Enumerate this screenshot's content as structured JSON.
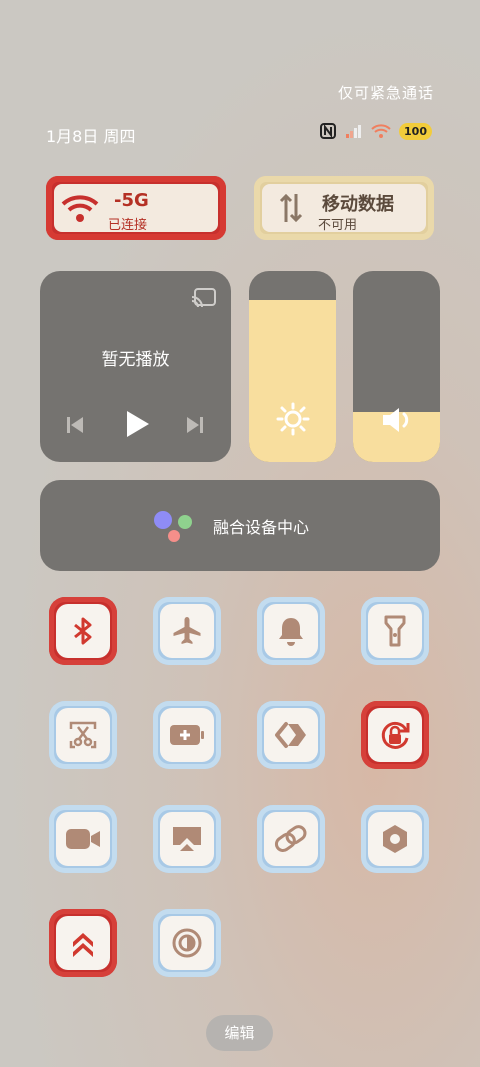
{
  "status": {
    "emergency_text": "仅可紧急通话",
    "date": "1月8日 周四",
    "battery": "100"
  },
  "wifi_card": {
    "title": "-5G",
    "status": "已连接"
  },
  "data_card": {
    "title": "移动数据",
    "status": "不可用"
  },
  "media": {
    "title": "暂无播放"
  },
  "levels": {
    "brightness_fraction": 0.85,
    "volume_fraction": 0.26
  },
  "fusion": {
    "label": "融合设备中心"
  },
  "tiles": [
    "bluetooth-icon",
    "airplane-mode-icon",
    "bell-icon",
    "flashlight-icon",
    "screenshot-scissors-icon",
    "battery-saver-icon",
    "nearby-share-icon",
    "rotation-lock-icon",
    "screen-record-icon",
    "screen-cast-icon",
    "link-icon",
    "settings-hexagon-icon",
    "double-chevron-up-icon",
    "dark-mode-icon"
  ],
  "edit_label": "编辑",
  "colors": {
    "accent_yellow": "#f8de9e",
    "panel_gray": "#757370",
    "festive_red": "#c7302d",
    "tile_blue": "#a8c9e6",
    "icon_brown": "#b08a76"
  }
}
